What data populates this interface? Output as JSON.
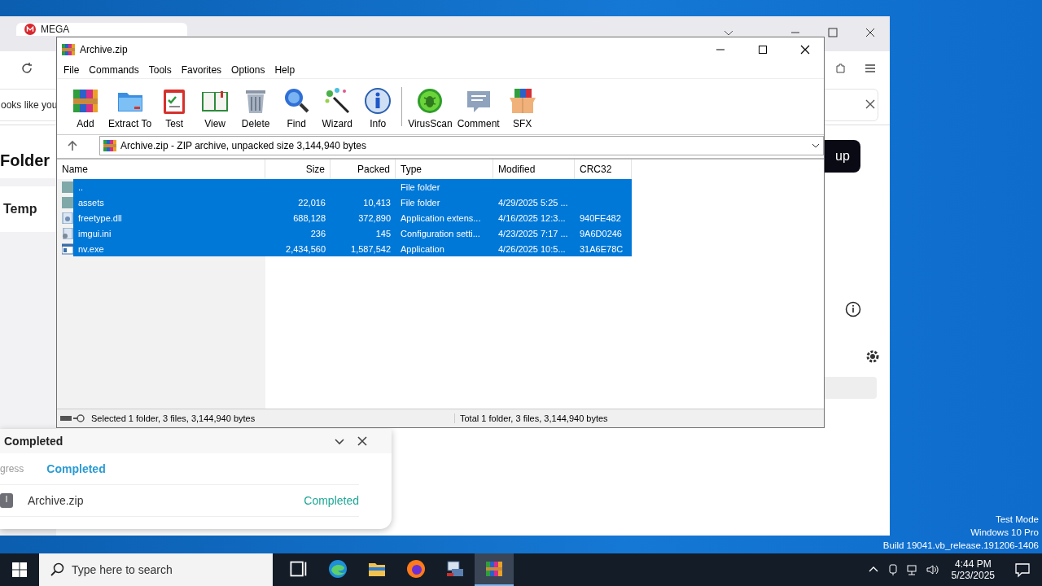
{
  "browser": {
    "tab": {
      "title": "MEGA"
    },
    "notice": {
      "text": "ooks like you"
    },
    "heading": "Folder",
    "sidebar_item": "Temp",
    "button": "up"
  },
  "downloads": {
    "title": "Completed",
    "progress_label": "gress",
    "progress_status": "Completed",
    "items": [
      {
        "name": "Archive.zip",
        "status": "Completed"
      }
    ]
  },
  "winrar": {
    "title": "Archive.zip",
    "menu": [
      "File",
      "Commands",
      "Tools",
      "Favorites",
      "Options",
      "Help"
    ],
    "toolbar_groups": [
      [
        {
          "label": "Add",
          "kind": "add"
        },
        {
          "label": "Extract To",
          "kind": "extract"
        },
        {
          "label": "Test",
          "kind": "test"
        },
        {
          "label": "View",
          "kind": "view"
        },
        {
          "label": "Delete",
          "kind": "delete"
        },
        {
          "label": "Find",
          "kind": "find"
        },
        {
          "label": "Wizard",
          "kind": "wizard"
        },
        {
          "label": "Info",
          "kind": "info"
        }
      ],
      [
        {
          "label": "VirusScan",
          "kind": "virusscan"
        },
        {
          "label": "Comment",
          "kind": "comment"
        },
        {
          "label": "SFX",
          "kind": "sfx"
        }
      ]
    ],
    "path": "Archive.zip - ZIP archive, unpacked size 3,144,940 bytes",
    "table": {
      "columns": [
        "Name",
        "Size",
        "Packed",
        "Type",
        "Modified",
        "CRC32"
      ],
      "rows": [
        {
          "kind": "folder",
          "selected": true,
          "name": "..",
          "type": "File folder"
        },
        {
          "kind": "folder",
          "selected": true,
          "name": "assets",
          "size": "22,016",
          "packed": "10,413",
          "type": "File folder",
          "modified": "4/29/2025 5:25 ..."
        },
        {
          "kind": "dll",
          "selected": true,
          "name": "freetype.dll",
          "size": "688,128",
          "packed": "372,890",
          "type": "Application extens...",
          "modified": "4/16/2025 12:3...",
          "crc32": "940FE482"
        },
        {
          "kind": "ini",
          "selected": true,
          "name": "imgui.ini",
          "size": "236",
          "packed": "145",
          "type": "Configuration setti...",
          "modified": "4/23/2025 7:17 ...",
          "crc32": "9A6D0246"
        },
        {
          "kind": "exe",
          "selected": true,
          "name": "nv.exe",
          "size": "2,434,560",
          "packed": "1,587,542",
          "type": "Application",
          "modified": "4/26/2025 10:5...",
          "crc32": "31A6E78C"
        }
      ]
    },
    "status_left": "Selected 1 folder, 3 files, 3,144,940 bytes",
    "status_right": "Total 1 folder, 3 files, 3,144,940 bytes"
  },
  "os_notice": [
    "Test Mode",
    "Windows 10 Pro",
    "Build 19041.vb_release.191206-1406"
  ],
  "taskbar": {
    "search": {
      "placeholder": "Type here to search"
    },
    "apps": [
      {
        "kind": "taskview",
        "selected": false
      },
      {
        "kind": "edge",
        "selected": false
      },
      {
        "kind": "explorer",
        "selected": false
      },
      {
        "kind": "firefox",
        "selected": false
      },
      {
        "kind": "installer",
        "selected": false
      },
      {
        "kind": "winrar",
        "selected": true
      }
    ],
    "time": "4:44 PM",
    "date": "5/23/2025"
  }
}
